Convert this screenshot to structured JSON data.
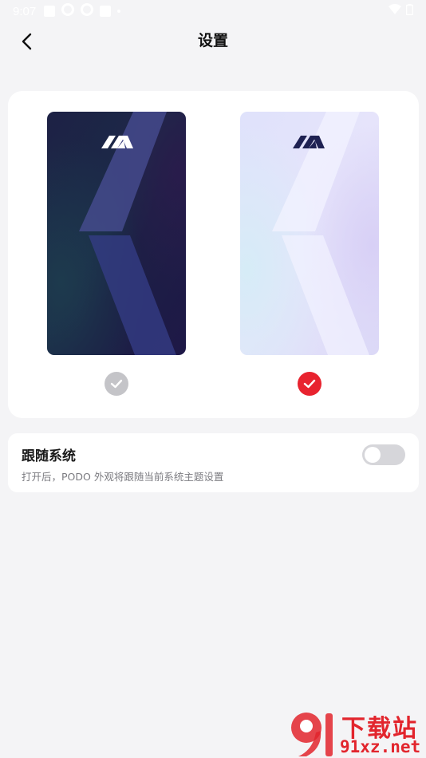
{
  "status_bar": {
    "time": "9:07",
    "icons": [
      "square-icon",
      "gear-icon",
      "gear-icon",
      "square-icon",
      "dot-icon"
    ],
    "right_icons": [
      "wifi-icon",
      "battery-icon"
    ]
  },
  "header": {
    "title": "设置",
    "back_icon": "chevron-left-icon"
  },
  "themes": {
    "dark": {
      "selected": false
    },
    "light": {
      "selected": true
    }
  },
  "follow_system": {
    "title": "跟随系统",
    "description": "打开后，PODO 外观将跟随当前系统主题设置",
    "enabled": false
  },
  "watermark": {
    "top_text": "下载站",
    "bottom_text": "91xz.net"
  },
  "colors": {
    "accent_red": "#e8232f",
    "check_off": "#c4c4c8",
    "toggle_off": "#d6d6da",
    "background": "#f4f4f6"
  }
}
